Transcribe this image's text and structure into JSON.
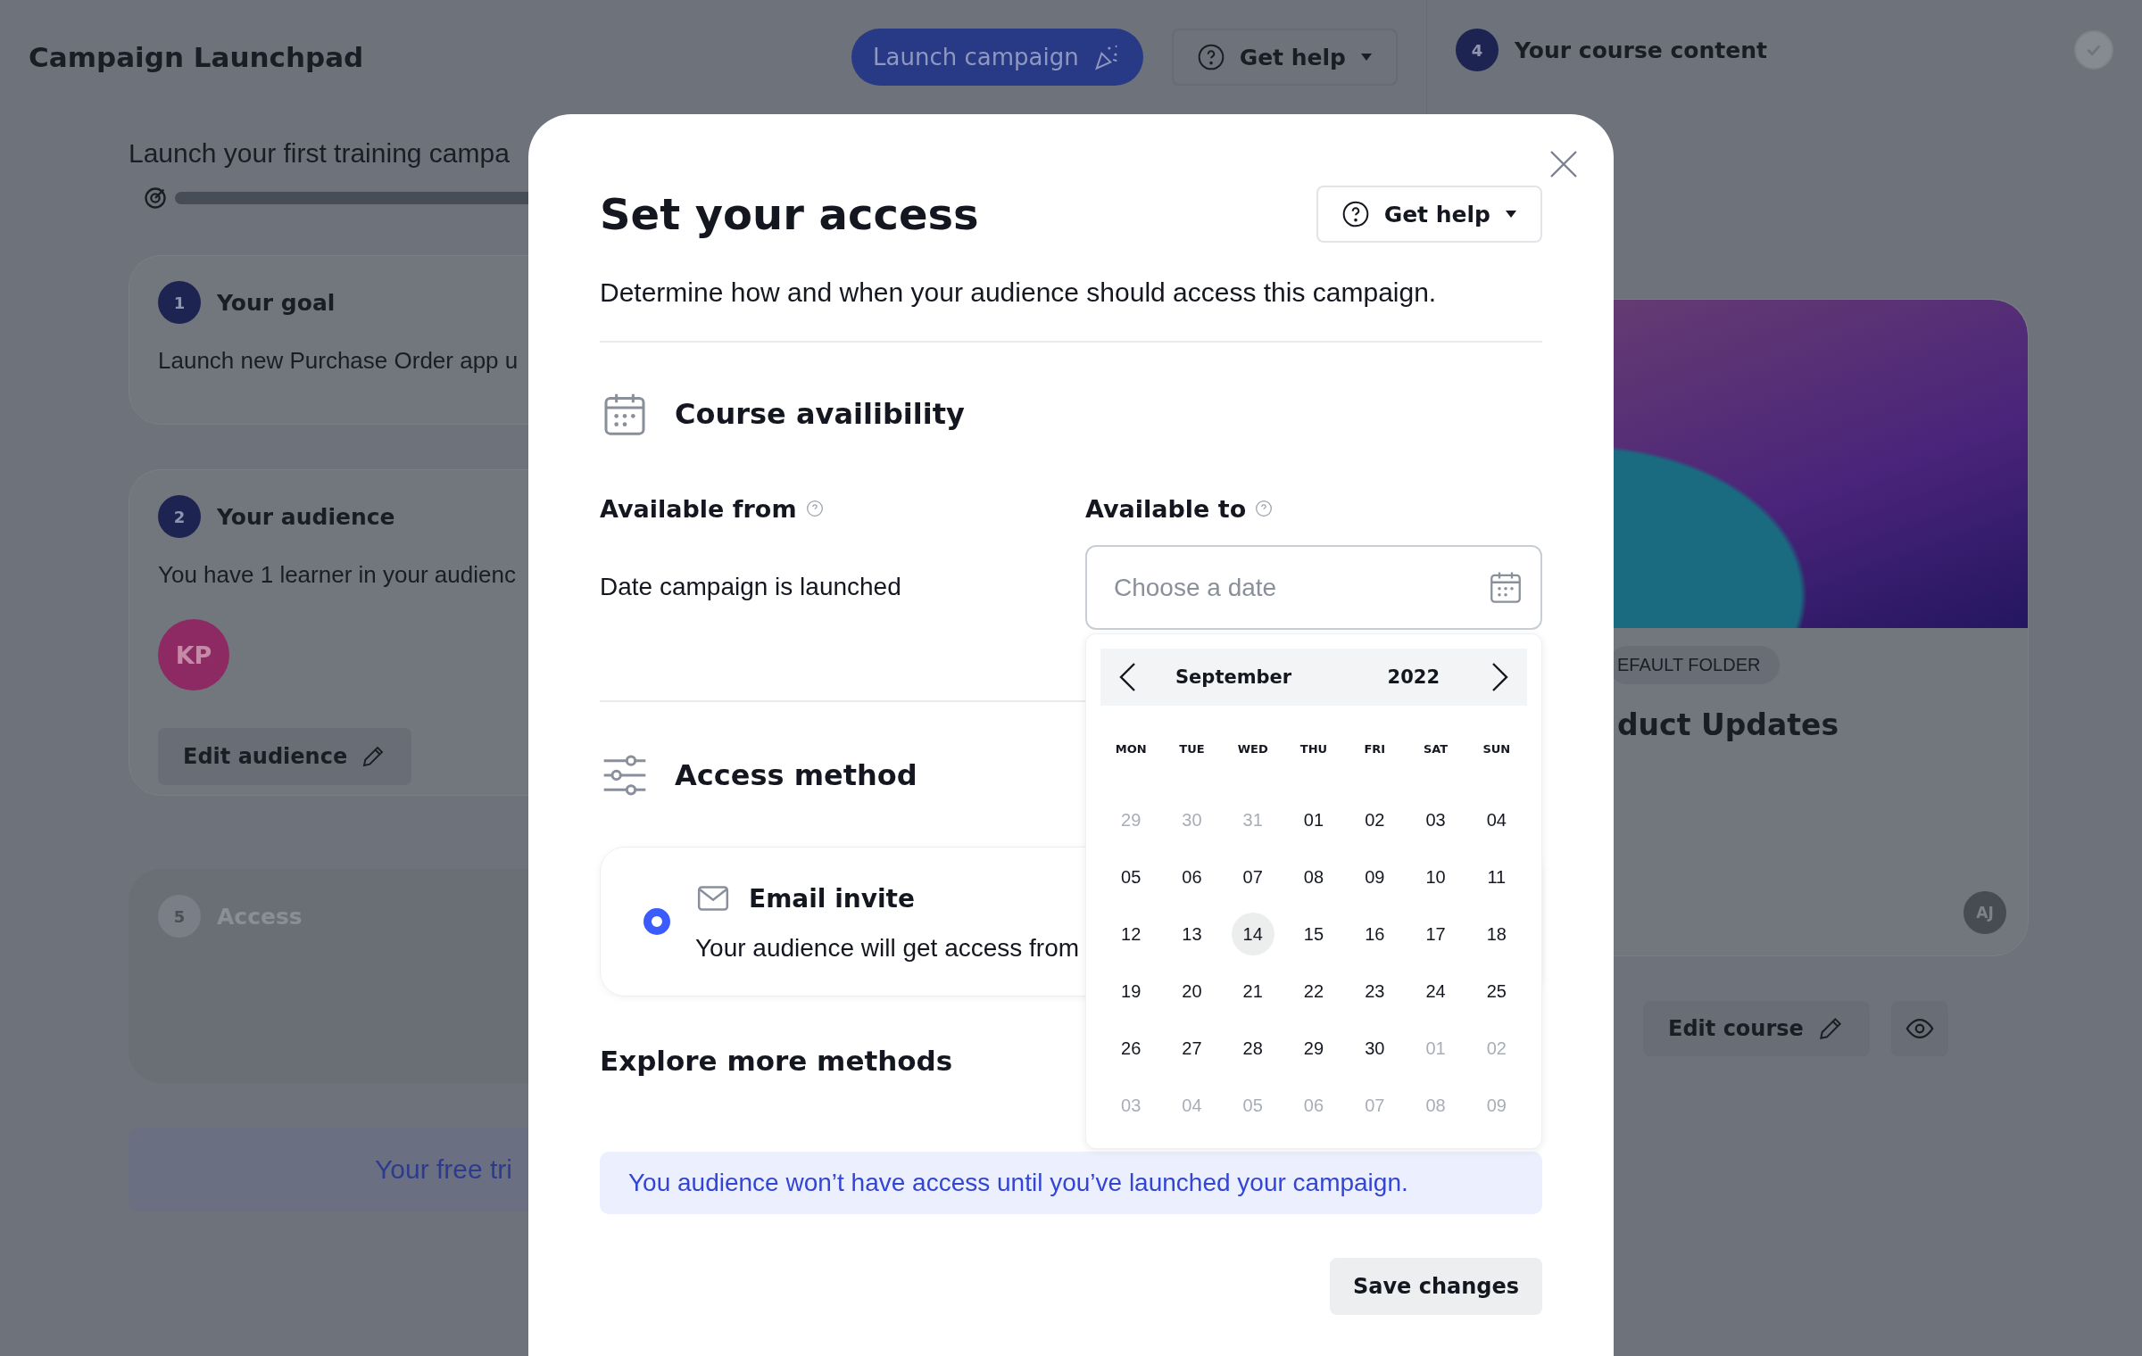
{
  "header": {
    "title": "Campaign Launchpad",
    "launch_button": "Launch campaign",
    "help_button": "Get help"
  },
  "progress": {
    "title": "Launch your first training campa"
  },
  "steps": [
    {
      "kind": "goal",
      "number": "1",
      "title": "Your goal",
      "disabled": false,
      "text": "Launch new Purchase Order app u"
    },
    {
      "kind": "audience",
      "number": "2",
      "title": "Your audience",
      "disabled": false,
      "text": "You have 1 learner in your audienc",
      "avatar": "KP",
      "button": "Edit audience"
    },
    {
      "kind": "access",
      "number": "5",
      "title": "Access",
      "disabled": true
    }
  ],
  "trial_banner": "Your free tri",
  "course_panel": {
    "number": "4",
    "title": "Your course content",
    "completed": true,
    "tag": "EFAULT FOLDER",
    "course_title": "duct Updates",
    "avatar": "AJ",
    "edit_button": "Edit course"
  },
  "modal": {
    "title": "Set your access",
    "help_button": "Get help",
    "description": "Determine how and when your audience should access this campaign.",
    "availability": {
      "title": "Course availibility",
      "from_label": "Available from",
      "from_value": "Date campaign is launched",
      "to_label": "Available to",
      "to_placeholder": "Choose a date"
    },
    "calendar": {
      "month": "September",
      "year": "2022",
      "weekdays": [
        "MON",
        "TUE",
        "WED",
        "THU",
        "FRI",
        "SAT",
        "SUN"
      ],
      "weeks": [
        [
          {
            "day": "29",
            "outside": true,
            "selected": false
          },
          {
            "day": "30",
            "outside": true,
            "selected": false
          },
          {
            "day": "31",
            "outside": true,
            "selected": false
          },
          {
            "day": "01",
            "outside": false,
            "selected": false
          },
          {
            "day": "02",
            "outside": false,
            "selected": false
          },
          {
            "day": "03",
            "outside": false,
            "selected": false
          },
          {
            "day": "04",
            "outside": false,
            "selected": false
          }
        ],
        [
          {
            "day": "05",
            "outside": false,
            "selected": false
          },
          {
            "day": "06",
            "outside": false,
            "selected": false
          },
          {
            "day": "07",
            "outside": false,
            "selected": false
          },
          {
            "day": "08",
            "outside": false,
            "selected": false
          },
          {
            "day": "09",
            "outside": false,
            "selected": false
          },
          {
            "day": "10",
            "outside": false,
            "selected": false
          },
          {
            "day": "11",
            "outside": false,
            "selected": false
          }
        ],
        [
          {
            "day": "12",
            "outside": false,
            "selected": false
          },
          {
            "day": "13",
            "outside": false,
            "selected": false
          },
          {
            "day": "14",
            "outside": false,
            "selected": true
          },
          {
            "day": "15",
            "outside": false,
            "selected": false
          },
          {
            "day": "16",
            "outside": false,
            "selected": false
          },
          {
            "day": "17",
            "outside": false,
            "selected": false
          },
          {
            "day": "18",
            "outside": false,
            "selected": false
          }
        ],
        [
          {
            "day": "19",
            "outside": false,
            "selected": false
          },
          {
            "day": "20",
            "outside": false,
            "selected": false
          },
          {
            "day": "21",
            "outside": false,
            "selected": false
          },
          {
            "day": "22",
            "outside": false,
            "selected": false
          },
          {
            "day": "23",
            "outside": false,
            "selected": false
          },
          {
            "day": "24",
            "outside": false,
            "selected": false
          },
          {
            "day": "25",
            "outside": false,
            "selected": false
          }
        ],
        [
          {
            "day": "26",
            "outside": false,
            "selected": false
          },
          {
            "day": "27",
            "outside": false,
            "selected": false
          },
          {
            "day": "28",
            "outside": false,
            "selected": false
          },
          {
            "day": "29",
            "outside": false,
            "selected": false
          },
          {
            "day": "30",
            "outside": false,
            "selected": false
          },
          {
            "day": "01",
            "outside": true,
            "selected": false
          },
          {
            "day": "02",
            "outside": true,
            "selected": false
          }
        ],
        [
          {
            "day": "03",
            "outside": true,
            "selected": false
          },
          {
            "day": "04",
            "outside": true,
            "selected": false
          },
          {
            "day": "05",
            "outside": true,
            "selected": false
          },
          {
            "day": "06",
            "outside": true,
            "selected": false
          },
          {
            "day": "07",
            "outside": true,
            "selected": false
          },
          {
            "day": "08",
            "outside": true,
            "selected": false
          },
          {
            "day": "09",
            "outside": true,
            "selected": false
          }
        ]
      ]
    },
    "access": {
      "title": "Access method",
      "methods": [
        {
          "title": "Email invite",
          "text": "Your audience will get access from",
          "selected": true
        }
      ]
    },
    "explore_title": "Explore more methods",
    "info": "You audience won’t have access until you’ve launched your campaign.",
    "save_button": "Save changes"
  }
}
